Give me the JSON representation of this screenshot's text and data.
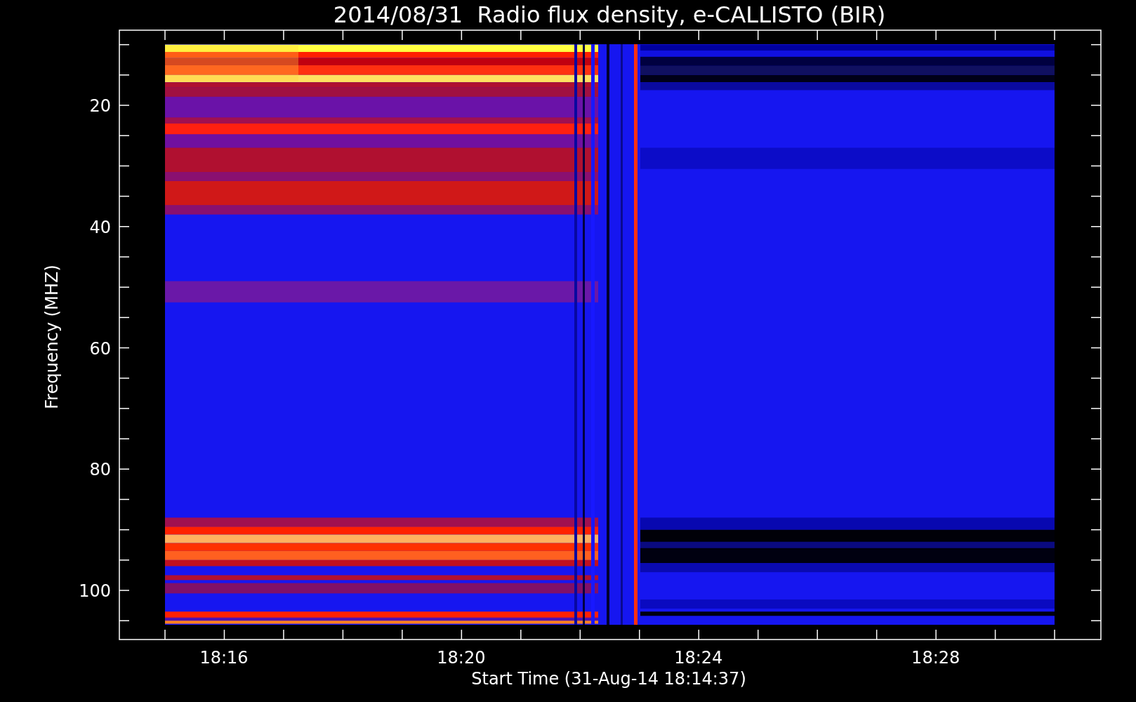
{
  "title": "2014/08/31  Radio flux density, e-CALLISTO (BIR)",
  "y_axis": {
    "label": "Frequency (MHZ)",
    "ticks": [
      "20",
      "40",
      "60",
      "80",
      "100"
    ]
  },
  "x_axis": {
    "label": "Start Time (31-Aug-14 18:14:37)",
    "ticks": [
      "18:16",
      "18:20",
      "18:24",
      "18:28"
    ]
  }
}
